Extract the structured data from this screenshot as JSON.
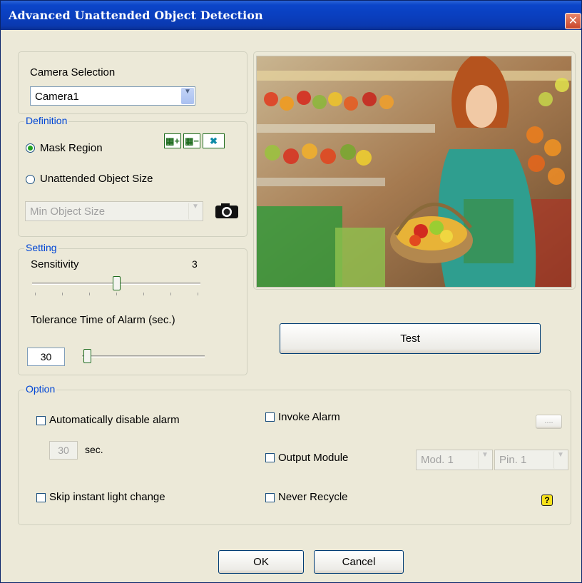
{
  "window": {
    "title": "Advanced Unattended Object Detection",
    "close_icon": "close-icon"
  },
  "camera": {
    "label": "Camera Selection",
    "value": "Camera1"
  },
  "definition": {
    "legend": "Definition",
    "mask_region": "Mask Region",
    "object_size": "Unattended Object Size",
    "size_combo": "Min Object Size",
    "selected": "mask_region",
    "tool_add": "▦+",
    "tool_remove": "▦−",
    "tool_clear": "✖",
    "snapshot_icon": "camera-icon"
  },
  "setting": {
    "legend": "Setting",
    "sensitivity_label": "Sensitivity",
    "sensitivity_value": "3",
    "sensitivity_level": 3,
    "sensitivity_max": 6,
    "tolerance_label": "Tolerance Time of Alarm (sec.)",
    "tolerance_value": "30"
  },
  "preview": {
    "test_label": "Test"
  },
  "option": {
    "legend": "Option",
    "auto_disable": "Automatically disable alarm",
    "auto_disable_secs": "30",
    "sec_label": "sec.",
    "skip_light": "Skip instant light change",
    "invoke_alarm": "Invoke Alarm",
    "browse": "....",
    "output_module": "Output Module",
    "module_combo": "Mod. 1",
    "pin_combo": "Pin. 1",
    "never_recycle": "Never Recycle",
    "help_icon": "?"
  },
  "footer": {
    "ok": "OK",
    "cancel": "Cancel"
  },
  "colors": {
    "title_bar": "#0a3fbf",
    "dialog": "#ece9d8",
    "legend": "#0046d5"
  }
}
